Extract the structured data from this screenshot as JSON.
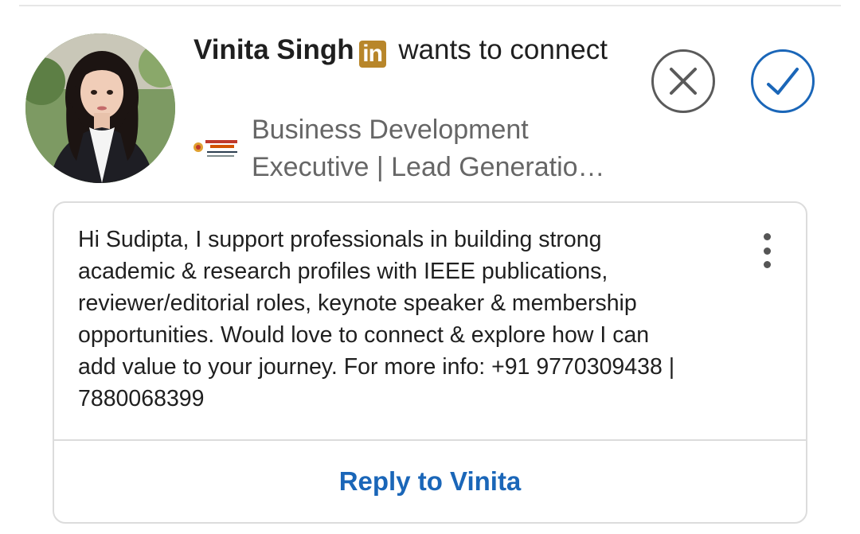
{
  "invitation": {
    "sender_name": "Vinita Singh",
    "badge_label": "in",
    "action_text": " wants to connect",
    "headline": "Business Development Executive | Lead Generatio…",
    "message": "Hi Sudipta, I support professionals in building strong academic & research profiles with IEEE publications, reviewer/editorial roles, keynote speaker & membership opportunities. Would love to connect & explore how I can add value to your journey. For more info: +91 9770309438 | 7880068399",
    "reply_label": "Reply to Vinita"
  },
  "icons": {
    "ignore": "close-icon",
    "accept": "checkmark-icon",
    "more": "more-vertical-icon",
    "badge": "linkedin-premium-icon"
  },
  "colors": {
    "accent_blue": "#1a66b8",
    "badge_gold": "#b8862a",
    "muted_text": "#666666",
    "border": "#dcdcdc"
  }
}
